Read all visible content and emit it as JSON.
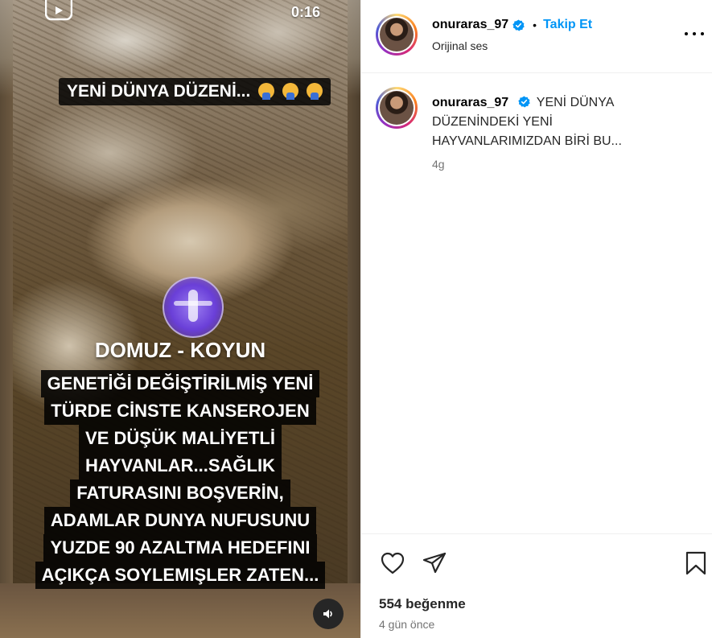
{
  "media": {
    "timer": "0:16",
    "caption_top": "YENİ DÜNYA DÜZENİ...",
    "subtitle": "DOMUZ - KOYUN",
    "caption_lines": [
      "GENETİĞİ DEĞİŞTİRİLMİŞ YENİ",
      "TÜRDE CİNSTE KANSEROJEN",
      "VE DÜŞÜK MALİYETLİ",
      "HAYVANLAR...SAĞLIK",
      "FATURASINI BOŞVERİN,",
      "ADAMLAR DUNYA NUFUSUNU",
      "YUZDE 90 AZALTMA HEDEFINI",
      "AÇIKÇA SOYLEMIŞLER ZATEN..."
    ],
    "watermark": "YENİ DÜNYA DÜZENİ"
  },
  "header": {
    "username": "onuraras_97",
    "separator": "•",
    "follow_label": "Takip Et",
    "audio": "Orijinal ses"
  },
  "comment": {
    "username": "onuraras_97",
    "text": "YENİ DÜNYA DÜZENİNDEKİ YENİ HAYVANLARIMIZDAN BİRİ BU...",
    "time": "4g"
  },
  "footer": {
    "likes": "554 beğenme",
    "date": "4 gün önce"
  },
  "colors": {
    "accent": "#0095f6",
    "verified": "#0095f6",
    "muted": "#737373"
  },
  "icons": [
    "reels-icon",
    "sound-icon",
    "verified-icon",
    "more-icon",
    "heart-icon",
    "share-icon",
    "bookmark-icon"
  ]
}
